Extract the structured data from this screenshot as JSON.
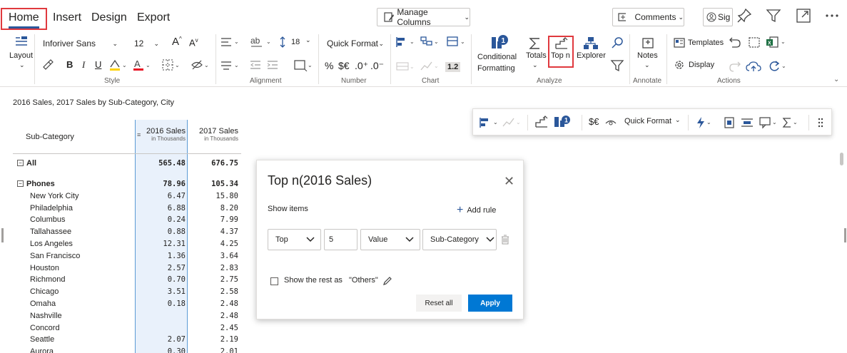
{
  "tabs": [
    {
      "label": "Home",
      "active": true
    },
    {
      "label": "Insert",
      "active": false
    },
    {
      "label": "Design",
      "active": false
    },
    {
      "label": "Export",
      "active": false
    }
  ],
  "top_actions": {
    "manage_columns": "Manage Columns",
    "comments": "Comments",
    "sign": "Sig"
  },
  "ribbon": {
    "layout_label": "Layout",
    "font_name": "Inforiver Sans",
    "font_size": "12",
    "line_spacing": "18",
    "quick_format": "Quick Format",
    "number_format_buttons": [
      "%",
      "$€",
      ".0⁺",
      ".0⁻"
    ],
    "decimal_label": "1.2",
    "conditional_formatting": "Conditional Formatting",
    "totals": "Totals",
    "top_n": "Top n",
    "explorer": "Explorer",
    "notes": "Notes",
    "templates": "Templates",
    "display": "Display",
    "groups": [
      "Style",
      "Alignment",
      "Number",
      "Chart",
      "Analyze",
      "Annotate",
      "Actions"
    ]
  },
  "report": {
    "subtitle": "2016 Sales, 2017 Sales by Sub-Category, City",
    "header_subcategory": "Sub-Category",
    "col1_title": "2016 Sales",
    "col1_sub": "in Thousands",
    "col2_title": "2017 Sales",
    "col2_sub": "in Thousands",
    "rows": [
      {
        "name": "All",
        "v1": "565.48",
        "v2": "676.75",
        "bold": true,
        "expander": "⊟"
      },
      {
        "name": "Phones",
        "v1": "78.96",
        "v2": "105.34",
        "bold": true,
        "expander": "⊟"
      },
      {
        "name": "New York City",
        "v1": "6.47",
        "v2": "15.80"
      },
      {
        "name": "Philadelphia",
        "v1": "6.88",
        "v2": "8.20"
      },
      {
        "name": "Columbus",
        "v1": "0.24",
        "v2": "7.99"
      },
      {
        "name": "Tallahassee",
        "v1": "0.88",
        "v2": "4.37"
      },
      {
        "name": "Los Angeles",
        "v1": "12.31",
        "v2": "4.25"
      },
      {
        "name": "San Francisco",
        "v1": "1.36",
        "v2": "3.64"
      },
      {
        "name": "Houston",
        "v1": "2.57",
        "v2": "2.83"
      },
      {
        "name": "Richmond",
        "v1": "0.70",
        "v2": "2.75"
      },
      {
        "name": "Chicago",
        "v1": "3.51",
        "v2": "2.58"
      },
      {
        "name": "Omaha",
        "v1": "0.18",
        "v2": "2.48"
      },
      {
        "name": "Nashville",
        "v1": "",
        "v2": "2.48"
      },
      {
        "name": "Concord",
        "v1": "",
        "v2": "2.45"
      },
      {
        "name": "Seattle",
        "v1": "2.07",
        "v2": "2.19"
      },
      {
        "name": "Aurora",
        "v1": "0.30",
        "v2": "2.01"
      }
    ]
  },
  "float_toolbar": {
    "quick_format": "Quick Format",
    "currency": "$€"
  },
  "dialog": {
    "title": "Top n(2016 Sales)",
    "show_items": "Show items",
    "add_rule": "Add rule",
    "select_direction": "Top",
    "count_value": "5",
    "select_measure": "Value",
    "select_dimension": "Sub-Category",
    "show_rest_label": "Show the rest as",
    "others_label": "\"Others\"",
    "reset_all": "Reset all",
    "apply": "Apply"
  },
  "colors": {
    "accent": "#0078d4",
    "highlight_box": "#e0393e",
    "column_highlight": "#e9f1fb"
  }
}
